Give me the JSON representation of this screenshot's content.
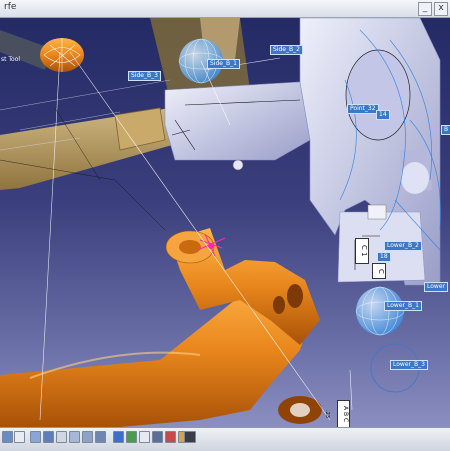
{
  "window": {
    "title_fragment": "rfe"
  },
  "viewport": {
    "side_tool_label": "st Tool",
    "labels": {
      "side_b2": "Side_B_2",
      "side_b3": "Side_B_3",
      "side_b1": "Side_B_1",
      "point_32": "Point_32",
      "val_14": "14",
      "right_b": "B",
      "lower_b2": "Lower_B_2",
      "val_18": "18",
      "lower_right": "Lower",
      "lower_b1": "Lower_B_1",
      "lower_b3": "Lower_B_3"
    },
    "stack_text": [
      "C 1",
      "C"
    ],
    "abc_text": "A B C",
    "tiny_value": ".23"
  },
  "colors": {
    "orange_part": "#e8861c",
    "tan_part": "#b59a62",
    "steel_part": "#c9cce6",
    "label_blue": "#3a78c8",
    "wire_blue": "#2f7de0",
    "magenta": "#ff2aa8",
    "sky_top": "#232a64",
    "sky_bottom": "#8b8fc0"
  },
  "toolbar": {
    "icons": [
      "view-icon",
      "fit-all-icon",
      "pan-icon",
      "rotate-icon",
      "zoom-in-icon",
      "zoom-out-icon",
      "normal-view-icon",
      "iso-view-icon",
      "shading-icon",
      "hide-show-icon",
      "swap-icon",
      "measure-icon",
      "color-icon",
      "material-icon",
      "camera-icon"
    ]
  }
}
